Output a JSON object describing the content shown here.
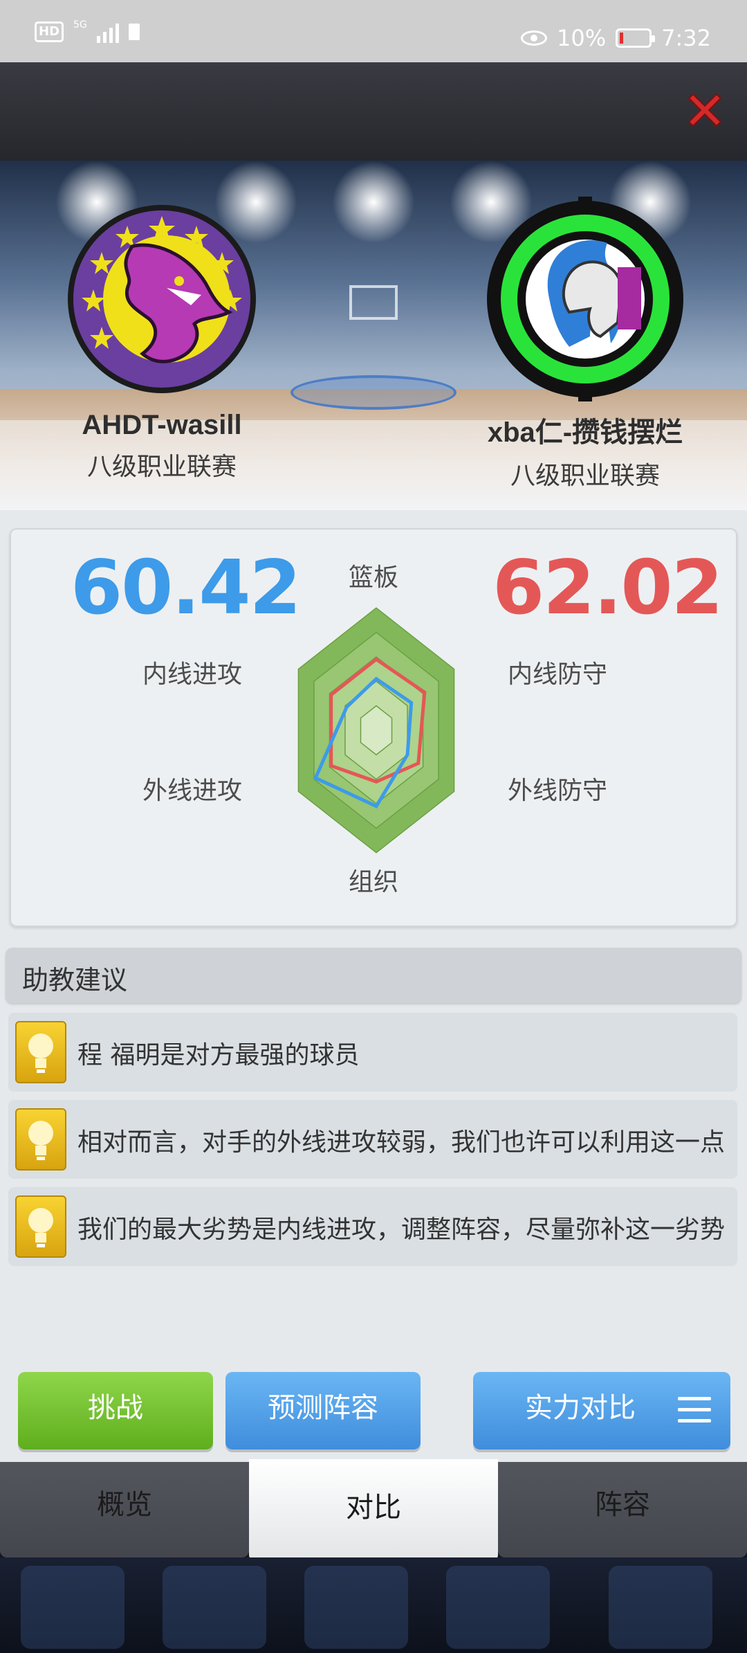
{
  "status_bar": {
    "hd_badge": "HD",
    "network": "5G",
    "battery_percent": "10%",
    "time": "7:32"
  },
  "teams": {
    "home": {
      "name": "AHDT-wasill",
      "league": "八级职业联赛",
      "score": "60.42",
      "color": "#3d9be9"
    },
    "away": {
      "name": "xba仁-攒钱摆烂",
      "league": "八级职业联赛",
      "score": "62.02",
      "color": "#e45757"
    }
  },
  "radar": {
    "axes": {
      "top": "篮板",
      "upper_left": "内线进攻",
      "lower_left": "外线进攻",
      "bottom": "组织",
      "upper_right": "内线防守",
      "lower_right": "外线防守"
    },
    "order": [
      "篮板",
      "内线防守",
      "外线防守",
      "组织",
      "外线进攻",
      "内线进攻"
    ],
    "home_values": [
      0.42,
      0.45,
      0.4,
      0.62,
      0.78,
      0.38
    ],
    "away_values": [
      0.58,
      0.62,
      0.54,
      0.42,
      0.58,
      0.58
    ]
  },
  "advice": {
    "title": "助教建议",
    "tips": [
      "程 福明是对方最强的球员",
      "相对而言，对手的外线进攻较弱，我们也许可以利用这一点",
      "我们的最大劣势是内线进攻，调整阵容，尽量弥补这一劣势"
    ]
  },
  "buttons": {
    "challenge": "挑战",
    "predict_lineup": "预测阵容",
    "strength_compare": "实力对比"
  },
  "tabs": {
    "overview": "概览",
    "compare": "对比",
    "lineup": "阵容",
    "active": "对比"
  }
}
